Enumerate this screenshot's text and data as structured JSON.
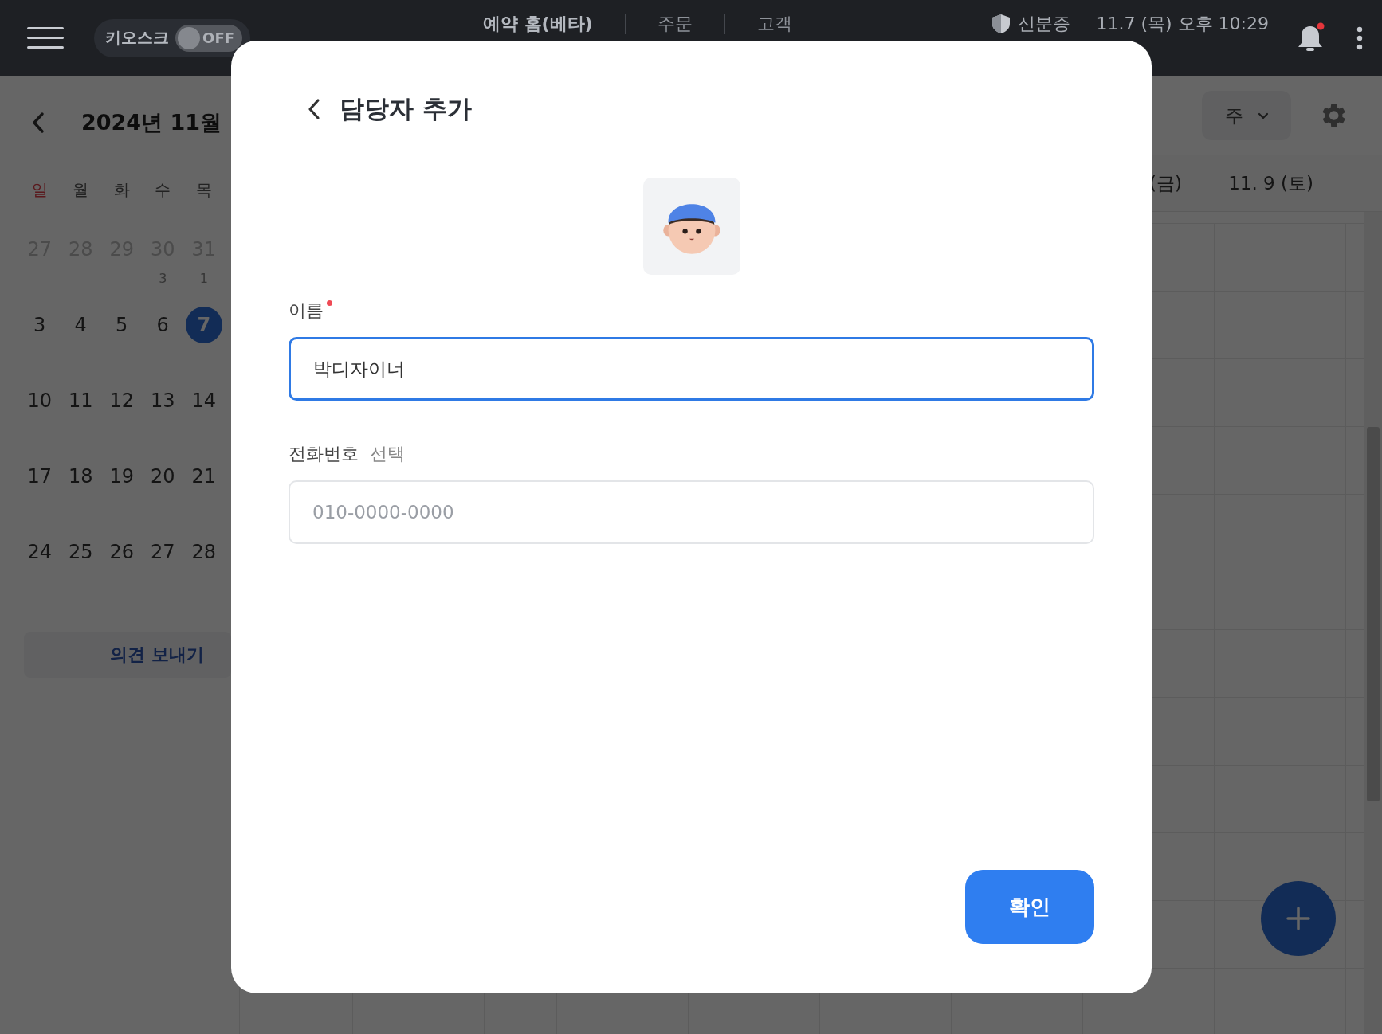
{
  "top_bar": {
    "kiosk": {
      "label": "키오스크",
      "toggle_text": "OFF",
      "on": false
    },
    "tabs": [
      {
        "label": "예약 홈(베타)",
        "selected": true
      },
      {
        "label": "주문",
        "selected": false
      },
      {
        "label": "고객",
        "selected": false
      }
    ],
    "id_button": "신분증",
    "datetime": "11.7 (목) 오후 10:29",
    "has_notification": true
  },
  "calendar": {
    "month": "2024년 11월",
    "weekdays": [
      {
        "label": "일",
        "sunday": true
      },
      {
        "label": "월",
        "sunday": false
      },
      {
        "label": "화",
        "sunday": false
      },
      {
        "label": "수",
        "sunday": false
      },
      {
        "label": "목",
        "sunday": false
      }
    ],
    "weeks": [
      [
        {
          "day": "27",
          "muted": true,
          "selected": false
        },
        {
          "day": "28",
          "muted": true,
          "selected": false
        },
        {
          "day": "29",
          "muted": true,
          "selected": false
        },
        {
          "day": "30",
          "muted": true,
          "selected": false,
          "count": "3"
        },
        {
          "day": "31",
          "muted": true,
          "selected": false,
          "count": "1"
        }
      ],
      [
        {
          "day": "3",
          "muted": false,
          "selected": false
        },
        {
          "day": "4",
          "muted": false,
          "selected": false
        },
        {
          "day": "5",
          "muted": false,
          "selected": false
        },
        {
          "day": "6",
          "muted": false,
          "selected": false
        },
        {
          "day": "7",
          "muted": false,
          "selected": true
        }
      ],
      [
        {
          "day": "10",
          "muted": false,
          "selected": false
        },
        {
          "day": "11",
          "muted": false,
          "selected": false
        },
        {
          "day": "12",
          "muted": false,
          "selected": false
        },
        {
          "day": "13",
          "muted": false,
          "selected": false
        },
        {
          "day": "14",
          "muted": false,
          "selected": false
        }
      ],
      [
        {
          "day": "17",
          "muted": false,
          "selected": false
        },
        {
          "day": "18",
          "muted": false,
          "selected": false
        },
        {
          "day": "19",
          "muted": false,
          "selected": false
        },
        {
          "day": "20",
          "muted": false,
          "selected": false
        },
        {
          "day": "21",
          "muted": false,
          "selected": false
        }
      ],
      [
        {
          "day": "24",
          "muted": false,
          "selected": false
        },
        {
          "day": "25",
          "muted": false,
          "selected": false
        },
        {
          "day": "26",
          "muted": false,
          "selected": false
        },
        {
          "day": "27",
          "muted": false,
          "selected": false
        },
        {
          "day": "28",
          "muted": false,
          "selected": false
        }
      ]
    ],
    "feedback_button": "의견 보내기"
  },
  "week_view": {
    "view_select": "주",
    "column_headers": [
      "(금)",
      "11. 9 (토)"
    ]
  },
  "dialog": {
    "title": "담당자 추가",
    "fields": [
      {
        "label": "이름",
        "required": true,
        "focused": true,
        "value": "박디자이너"
      },
      {
        "label": "전화번호",
        "required": false,
        "focused": false,
        "optional_tag": "선택",
        "placeholder": "010-0000-0000"
      }
    ],
    "confirm_button": "확인"
  }
}
